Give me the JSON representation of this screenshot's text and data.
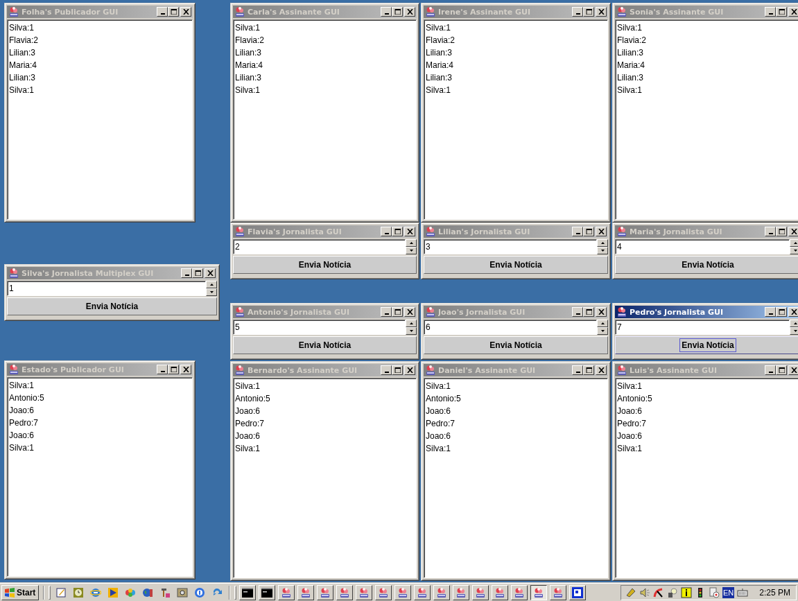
{
  "windows": [
    {
      "kind": "list",
      "title": "Folha's Publicador GUI",
      "active": false,
      "items": [
        "Silva:1",
        "Flavia:2",
        "Lilian:3",
        "Maria:4",
        "Lilian:3",
        "Silva:1"
      ]
    },
    {
      "kind": "list",
      "title": "Carla's Assinante GUI",
      "active": false,
      "items": [
        "Silva:1",
        "Flavia:2",
        "Lilian:3",
        "Maria:4",
        "Lilian:3",
        "Silva:1"
      ]
    },
    {
      "kind": "list",
      "title": "Irene's Assinante GUI",
      "active": false,
      "items": [
        "Silva:1",
        "Flavia:2",
        "Lilian:3",
        "Maria:4",
        "Lilian:3",
        "Silva:1"
      ]
    },
    {
      "kind": "list",
      "title": "Sonia's Assinante GUI",
      "active": false,
      "items": [
        "Silva:1",
        "Flavia:2",
        "Lilian:3",
        "Maria:4",
        "Lilian:3",
        "Silva:1"
      ]
    },
    {
      "kind": "sender",
      "title": "Flavia's Jornalista GUI",
      "active": false,
      "value": "2",
      "button": {
        "label": "Envia Notícia",
        "focused": false
      }
    },
    {
      "kind": "sender",
      "title": "Lilian's Jornalista GUI",
      "active": false,
      "value": "3",
      "button": {
        "label": "Envia Notícia",
        "focused": false
      }
    },
    {
      "kind": "sender",
      "title": "Maria's Jornalista GUI",
      "active": false,
      "value": "4",
      "button": {
        "label": "Envia Notícia",
        "focused": false
      }
    },
    {
      "kind": "sender",
      "title": "Silva's Jornalista Multiplex GUI",
      "active": false,
      "value": "1",
      "button": {
        "label": "Envia Notícia",
        "focused": false
      }
    },
    {
      "kind": "sender",
      "title": "Antonio's Jornalista GUI",
      "active": false,
      "value": "5",
      "button": {
        "label": "Envia Notícia",
        "focused": false
      }
    },
    {
      "kind": "sender",
      "title": "Joao's Jornalista GUI",
      "active": false,
      "value": "6",
      "button": {
        "label": "Envia Notícia",
        "focused": false
      }
    },
    {
      "kind": "sender",
      "title": "Pedro's Jornalista GUI",
      "active": true,
      "value": "7",
      "button": {
        "label": "Envia Notícia",
        "focused": true
      }
    },
    {
      "kind": "list",
      "title": "Estado's Publicador GUI",
      "active": false,
      "items": [
        "Silva:1",
        "Antonio:5",
        "Joao:6",
        "Pedro:7",
        "Joao:6",
        "Silva:1"
      ]
    },
    {
      "kind": "list",
      "title": "Bernardo's Assinante GUI",
      "active": false,
      "items": [
        "Silva:1",
        "Antonio:5",
        "Joao:6",
        "Pedro:7",
        "Joao:6",
        "Silva:1"
      ]
    },
    {
      "kind": "list",
      "title": "Daniel's Assinante GUI",
      "active": false,
      "items": [
        "Silva:1",
        "Antonio:5",
        "Joao:6",
        "Pedro:7",
        "Joao:6",
        "Silva:1"
      ]
    },
    {
      "kind": "list",
      "title": "Luis's Assinante GUI",
      "active": false,
      "items": [
        "Silva:1",
        "Antonio:5",
        "Joao:6",
        "Pedro:7",
        "Joao:6",
        "Silva:1"
      ]
    }
  ],
  "taskbar": {
    "start": "Start",
    "tasks": [
      {
        "kind": "console",
        "selected": false
      },
      {
        "kind": "console",
        "selected": false
      },
      {
        "kind": "java",
        "selected": false
      },
      {
        "kind": "java",
        "selected": false
      },
      {
        "kind": "java",
        "selected": false
      },
      {
        "kind": "java",
        "selected": false
      },
      {
        "kind": "java",
        "selected": false
      },
      {
        "kind": "java",
        "selected": false
      },
      {
        "kind": "java",
        "selected": false
      },
      {
        "kind": "java",
        "selected": false
      },
      {
        "kind": "java",
        "selected": false
      },
      {
        "kind": "java",
        "selected": false
      },
      {
        "kind": "java",
        "selected": false
      },
      {
        "kind": "java",
        "selected": false
      },
      {
        "kind": "java",
        "selected": false
      },
      {
        "kind": "java",
        "selected": true
      },
      {
        "kind": "java",
        "selected": false
      },
      {
        "kind": "dialog",
        "selected": false
      }
    ],
    "tray": {
      "language": "EN",
      "clock": "2:25 PM"
    }
  }
}
